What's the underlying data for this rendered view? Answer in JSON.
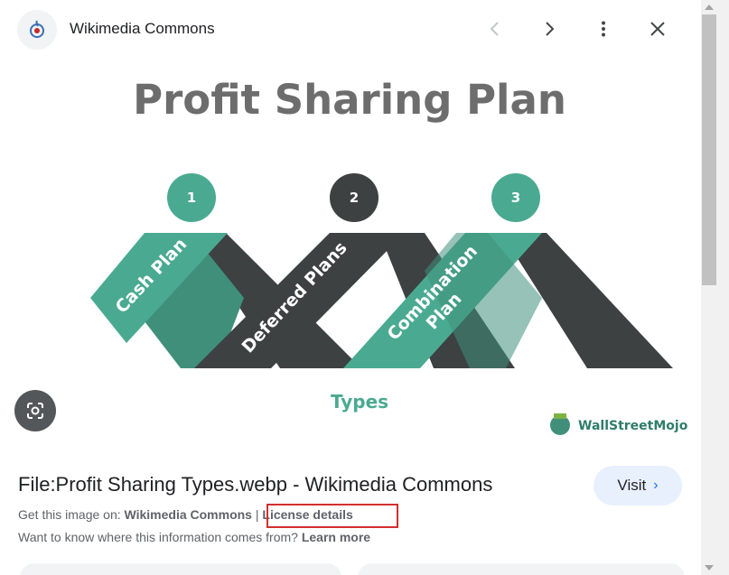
{
  "header": {
    "site_name": "Wikimedia Commons",
    "logo_icon": "wikimedia-commons-logo",
    "prev_icon": "chevron-left-icon",
    "next_icon": "chevron-right-icon",
    "more_icon": "more-vert-icon",
    "close_icon": "close-icon"
  },
  "image": {
    "title": "Profit Sharing Plan",
    "numbers": [
      "1",
      "2",
      "3"
    ],
    "ribbon_labels": [
      "Cash Plan",
      "Deferred Plans",
      "Combination",
      "Plan"
    ],
    "footer_label": "Types",
    "brand": "WallStreetMojo",
    "colors": {
      "teal": "#4aaa91",
      "dark": "#3d4142",
      "title_gray": "#6d6d6d"
    }
  },
  "lens": {
    "icon": "lens-search-icon"
  },
  "result": {
    "title": "File:Profit Sharing Types.webp - Wikimedia Commons",
    "visit_label": "Visit",
    "source_prefix": "Get this image on:",
    "source_name": "Wikimedia Commons",
    "separator": "|",
    "license_label": "License details",
    "learn_prefix": "Want to know where this information comes from?",
    "learn_more": "Learn more"
  }
}
